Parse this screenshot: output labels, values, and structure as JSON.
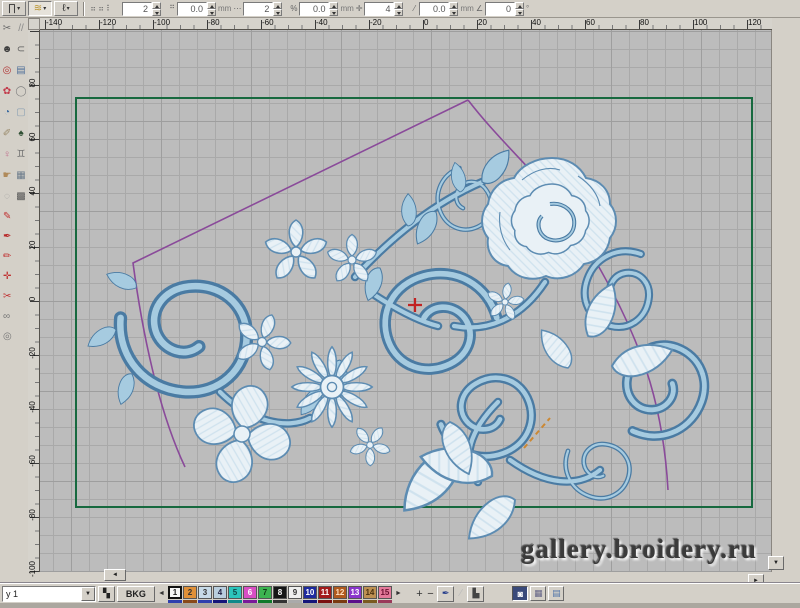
{
  "design": {
    "colors": {
      "chrome": "#d4d0c8",
      "canvas": "#bcbcbc",
      "grid": "#a9a9a9",
      "grid2": "#9e9e9e",
      "frame": "#17693f",
      "outline": "#8a4a9a",
      "pale": "#e9f1f6",
      "pale2": "#cfe2ee",
      "mid": "#5d8cb2",
      "mid2": "#a6cbe0",
      "dark": "#4a7ba3",
      "cross": "#c22222",
      "dash": "#cc8833"
    },
    "watermark": "gallery.broidery.ru"
  },
  "toolbar": {
    "stitch_buttons": [
      {
        "name": "satin-stitch-button",
        "glyph": "∏",
        "color": "#333333",
        "selected": false
      },
      {
        "name": "zigzag-stitch-button",
        "glyph": "≋",
        "color": "#b8912a",
        "selected": true
      },
      {
        "name": "run-stitch-button",
        "glyph": "ℓ",
        "color": "#333333",
        "selected": false
      }
    ],
    "small_icons": [
      {
        "name": "spacing-a-icon",
        "glyph": "⠶",
        "color": "#666666"
      },
      {
        "name": "spacing-b-icon",
        "glyph": "⠶",
        "color": "#666666"
      },
      {
        "name": "density-icon",
        "glyph": "⠇",
        "color": "#666666"
      }
    ],
    "fields": [
      {
        "name": "count-field",
        "pre_icon": "",
        "value": "2",
        "unit": ""
      },
      {
        "name": "stitch-length-field",
        "pre_icon": "⠛",
        "value": "0.0",
        "unit": "mm"
      },
      {
        "name": "repeat-field",
        "pre_icon": "⋯",
        "value": "2",
        "unit": ""
      },
      {
        "name": "offset-field",
        "pre_icon": "%",
        "value": "0.0",
        "unit": "mm"
      },
      {
        "name": "nudge-field",
        "pre_icon": "✛",
        "value": "4",
        "unit": ""
      },
      {
        "name": "width-field",
        "pre_icon": "⁄",
        "value": "0.0",
        "unit": "mm"
      },
      {
        "name": "angle-field",
        "pre_icon": "∠",
        "value": "0",
        "unit": "°"
      }
    ]
  },
  "rulers": {
    "horizontal": [
      "-140",
      "-120",
      "-100",
      "-80",
      "-60",
      "-40",
      "-20",
      "0",
      "20",
      "40",
      "60",
      "80",
      "100",
      "120"
    ],
    "vertical": [
      "80",
      "60",
      "40",
      "20",
      "0",
      "-20",
      "-40",
      "-60",
      "-80",
      "-100"
    ]
  },
  "left_toolbar_pairs": [
    {
      "name": "scissors-icon",
      "glyph": "✂",
      "color": "#6a6a6a"
    },
    {
      "name": "hatch-lines-icon",
      "glyph": "//",
      "color": "#8a8a8a"
    },
    {
      "name": "thread-knot-icon",
      "glyph": "☻",
      "color": "#3d3d3d"
    },
    {
      "name": "arc-tool-icon",
      "glyph": "⊂",
      "color": "#5a5a5a"
    },
    {
      "name": "red-ring-icon",
      "glyph": "◎",
      "color": "#b03030"
    },
    {
      "name": "image-flag-icon",
      "glyph": "▤",
      "color": "#50709a"
    },
    {
      "name": "flower-stitch-icon",
      "glyph": "✿",
      "color": "#c23a4a"
    },
    {
      "name": "ellipse-tool-icon",
      "glyph": "◯",
      "color": "#808080"
    },
    {
      "name": "pie-fill-icon",
      "glyph": "◔",
      "color": "#3a6aa0"
    },
    {
      "name": "rect-fill-icon",
      "glyph": "▢",
      "color": "#8ba0b4"
    },
    {
      "name": "lasso-tool-icon",
      "glyph": "✐",
      "color": "#9a8a6a"
    },
    {
      "name": "leaf-stitch-icon",
      "glyph": "♠",
      "color": "#2f4f33"
    },
    {
      "name": "figure-tool-icon",
      "glyph": "♀",
      "color": "#c06a8a"
    },
    {
      "name": "figures-pair-icon",
      "glyph": "♊",
      "color": "#6f6f6f"
    },
    {
      "name": "hand-tool-icon",
      "glyph": "☛",
      "color": "#b08a5a"
    },
    {
      "name": "photo-tool-icon",
      "glyph": "▦",
      "color": "#6a7a8a"
    },
    {
      "name": "dot-tool-icon",
      "glyph": "◌",
      "color": "#9a9a9a"
    },
    {
      "name": "checker-pattern-icon",
      "glyph": "▩",
      "color": "#555555"
    }
  ],
  "left_toolbar_singles": [
    {
      "name": "red-pen-icon",
      "glyph": "✎",
      "color": "#c03030"
    },
    {
      "name": "red-needle-icon",
      "glyph": "✒",
      "color": "#b82828"
    },
    {
      "name": "red-pencil-icon",
      "glyph": "✏",
      "color": "#c03030"
    },
    {
      "name": "red-stitch-icon",
      "glyph": "✛",
      "color": "#c03030"
    },
    {
      "name": "red-knife-icon",
      "glyph": "✂",
      "color": "#c03030"
    },
    {
      "name": "linked-circles-icon",
      "glyph": "∞",
      "color": "#777777"
    },
    {
      "name": "target-circle-icon",
      "glyph": "◎",
      "color": "#777777"
    }
  ],
  "scrollbar": {
    "left_arrow": "◄",
    "right_arrow": "►",
    "down_arrow": "▼"
  },
  "palette": {
    "layer_select": "y 1",
    "combo_arrow": "▼",
    "color_grid_icon": "▚",
    "bkg_label": "BKG",
    "prev_arrow": "◄",
    "next_arrow": "►",
    "swatches": [
      {
        "n": "1",
        "bg": "#f6f6f6",
        "fg": "#222222",
        "bar": "#2f3fae",
        "selected": true
      },
      {
        "n": "2",
        "bg": "#e09038",
        "fg": "#333333",
        "bar": "#8a4a1a",
        "selected": false
      },
      {
        "n": "3",
        "bg": "#c7dae8",
        "fg": "#333333",
        "bar": "#2f3fae",
        "selected": false
      },
      {
        "n": "4",
        "bg": "#b9cede",
        "fg": "#222244",
        "bar": "#15157a",
        "selected": false
      },
      {
        "n": "5",
        "bg": "#2cc4bc",
        "fg": "#104444",
        "bar": "#0f8a8a",
        "selected": false
      },
      {
        "n": "6",
        "bg": "#d94ec4",
        "fg": "#ffffff",
        "bar": "#7a1a9a",
        "selected": false
      },
      {
        "n": "7",
        "bg": "#3cb450",
        "fg": "#0f3a16",
        "bar": "#0f7a2a",
        "selected": false
      },
      {
        "n": "8",
        "bg": "#161616",
        "fg": "#ffffff",
        "bar": "#333333",
        "selected": false
      },
      {
        "n": "9",
        "bg": "#efefef",
        "fg": "#333333",
        "bar": "#aaaaaa",
        "selected": false
      },
      {
        "n": "10",
        "bg": "#1e2a9e",
        "fg": "#ffffff",
        "bar": "#15157a",
        "selected": false
      },
      {
        "n": "11",
        "bg": "#a31a1a",
        "fg": "#ffffff",
        "bar": "#7a1010",
        "selected": false
      },
      {
        "n": "12",
        "bg": "#b05a1e",
        "fg": "#ffe0c0",
        "bar": "#7a3a10",
        "selected": false
      },
      {
        "n": "13",
        "bg": "#8a35cc",
        "fg": "#ffffff",
        "bar": "#5a0f8a",
        "selected": false
      },
      {
        "n": "14",
        "bg": "#bd9052",
        "fg": "#4a3210",
        "bar": "#7a5a20",
        "selected": false
      },
      {
        "n": "15",
        "bg": "#e4799a",
        "fg": "#6a1030",
        "bar": "#9a3a5a",
        "selected": false
      }
    ],
    "add_label": "+",
    "remove_label": "−",
    "dye_icon": "✒",
    "disabled_icon": "⁄",
    "chart_icon": "▙",
    "view_buttons": [
      {
        "name": "view-toggle-1-button",
        "glyph": "◙",
        "color": "#ffffff",
        "selected": true
      },
      {
        "name": "view-toggle-2-button",
        "glyph": "▦",
        "color": "#666688",
        "selected": false
      },
      {
        "name": "view-toggle-3-button",
        "glyph": "▤",
        "color": "#5577aa",
        "selected": false
      }
    ]
  }
}
